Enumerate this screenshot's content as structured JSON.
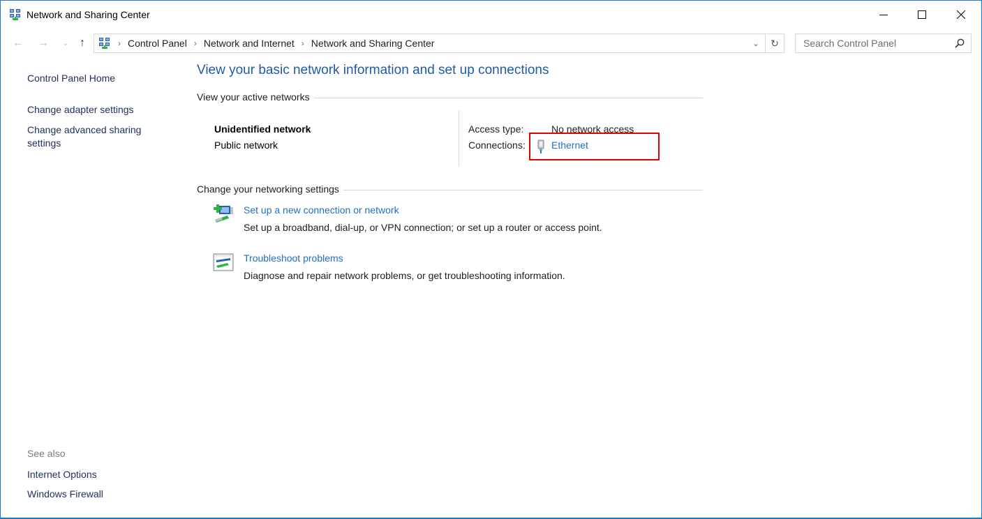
{
  "window": {
    "title": "Network and Sharing Center",
    "controls": {
      "minimize": "minimize",
      "maximize": "maximize",
      "close": "close"
    }
  },
  "navigation": {
    "back_icon": "←",
    "forward_icon": "→",
    "recent_icon": "⌄",
    "up_icon": "↑",
    "breadcrumbs": [
      "Control Panel",
      "Network and Internet",
      "Network and Sharing Center"
    ],
    "separator": "›",
    "dropdown_icon": "⌄",
    "refresh_icon": "↻",
    "search_placeholder": "Search Control Panel"
  },
  "sidebar": {
    "home": "Control Panel Home",
    "links": [
      "Change adapter settings",
      "Change advanced sharing settings"
    ],
    "see_also_label": "See also",
    "see_also_links": [
      "Internet Options",
      "Windows Firewall"
    ]
  },
  "main": {
    "title": "View your basic network information and set up connections",
    "active_networks": {
      "heading": "View your active networks",
      "network_name": "Unidentified network",
      "network_type": "Public network",
      "access_type_label": "Access type:",
      "access_type_value": "No network access",
      "connections_label": "Connections:",
      "connection_name": "Ethernet"
    },
    "settings": {
      "heading": "Change your networking settings",
      "tasks": [
        {
          "icon": "new-connection-icon",
          "title": "Set up a new connection or network",
          "description": "Set up a broadband, dial-up, or VPN connection; or set up a router or access point."
        },
        {
          "icon": "troubleshoot-icon",
          "title": "Troubleshoot problems",
          "description": "Diagnose and repair network problems, or get troubleshooting information."
        }
      ]
    }
  },
  "colors": {
    "window_border": "#1979ca",
    "link_blue": "#1f6fc6",
    "title_blue": "#1e5aa8",
    "sidebar_link": "#1f2d5e",
    "highlight_red": "#e00000"
  }
}
